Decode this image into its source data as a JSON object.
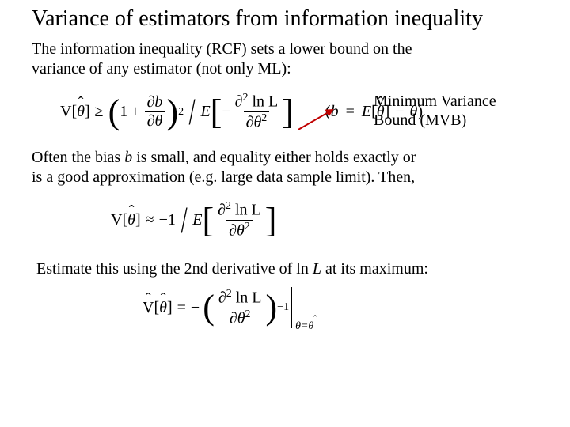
{
  "title": "Variance of estimators from information inequality",
  "p1a": "The information inequality (RCF) sets a lower bound on the",
  "p1b": "variance of any estimator (not only ML):",
  "annotation1": "Minimum Variance",
  "annotation2": "Bound (MVB)",
  "p2a": "Often the bias ",
  "p2b_i": "b",
  "p2c": " is small, and equality either holds exactly or",
  "p2d": "is a good approximation (e.g. large data sample limit).   Then,",
  "p3a": "Estimate this using the 2nd derivative of  ln ",
  "p3b_i": "L",
  "p3c": " at its maximum:",
  "eq1": {
    "V": "V",
    "th": "θ",
    "ge": "≥",
    "one": "1",
    "plus": "+",
    "db": "∂b",
    "dth": "∂θ",
    "two": "2",
    "E": "E",
    "minus": "−",
    "d2lnL": "∂",
    "lnL": "ln L",
    "dth2": "∂θ",
    "b": "b",
    "eq": "=",
    "mth": "θ"
  },
  "eq2": {
    "V": "V",
    "th": "θ",
    "approx": "≈",
    "m1": "−1",
    "E": "E",
    "d2": "∂",
    "lnL": "ln L",
    "dth2": "∂θ",
    "two": "2"
  },
  "eq3": {
    "Vh": "V",
    "th": "θ",
    "eq": "=",
    "minus": "−",
    "d2": "∂",
    "lnL": "ln L",
    "dth2": "∂θ",
    "two": "2",
    "m1": "−1",
    "sub": "θ=θ"
  }
}
